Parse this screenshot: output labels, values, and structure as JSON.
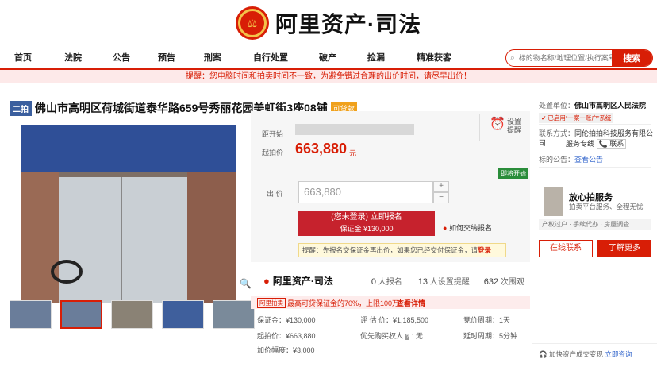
{
  "header": {
    "brand": "阿里资产·司法"
  },
  "nav": {
    "items": [
      "首页",
      "法院",
      "公告",
      "预告",
      "刑案",
      "自行处置",
      "破产",
      "捡漏",
      "精准获客"
    ],
    "search_placeholder": "标的物名称/地理位置/执行案号",
    "search_button": "搜索"
  },
  "notice": "提醒：您电脑时间和拍卖时间不一致，为避免错过合理的出价时间，请尽早出价！",
  "listing": {
    "round_tag": "二拍",
    "title": "佛山市高明区荷城街道泰华路659号秀丽花园美虹街3座08铺",
    "loan_tag": "可贷款",
    "countdown_label": "距开始",
    "start_price_label": "起拍价",
    "start_price": "663,880",
    "currency": "元",
    "remind_label": "设置提醒",
    "status_badge": "即将开始"
  },
  "bid": {
    "label": "出  价",
    "value": "663,880",
    "register_line1": "(您未登录) 立即报名",
    "register_line2": "保证金 ¥130,000",
    "howto": "如何交纳报名",
    "tip_prefix": "提醒：先报名交保证金再出价，如果您已经交付保证金，请",
    "tip_login": "登录"
  },
  "stats": {
    "logo": "阿里资产·司法",
    "signups": "0",
    "signups_label": "人报名",
    "reminders": "13",
    "reminders_label": "人设置提醒",
    "views": "632",
    "views_label": "次围观"
  },
  "promo": {
    "tag": "阿里拍卖",
    "text": "最高可贷保证金的70%，上限100万",
    "more": "查看详情"
  },
  "details": {
    "deposit": "保证金：¥130,000",
    "appraisal": "评 估 价：¥1,185,500",
    "cycle": "竞价周期：1天",
    "start": "起拍价：¥663,880",
    "priority": "优先购买权人",
    "priority_value": "无",
    "delay": "延时周期：5分钟",
    "increment": "加价幅度：¥3,000"
  },
  "sidebar": {
    "court_label": "处置单位：",
    "court": "佛山市高明区人民法院",
    "verified": "已启用“一案一账户”系统",
    "contact_label": "联系方式：",
    "contact": "同伦拍拍科技服务有限公司",
    "hotline_label": "服务专线",
    "hotline_link": "联系",
    "notice_label": "标的公告：",
    "notice_link": "查看公告",
    "service_title": "放心拍服务",
    "service_sub": "拍卖平台服务、全程无忧",
    "service_tags": [
      "产权过户",
      "手续代办",
      "房屋调查"
    ],
    "online_contact": "在线联系",
    "learn_more": "了解更多",
    "footer": "加快资产成交变现",
    "footer_link": "立即咨询"
  }
}
